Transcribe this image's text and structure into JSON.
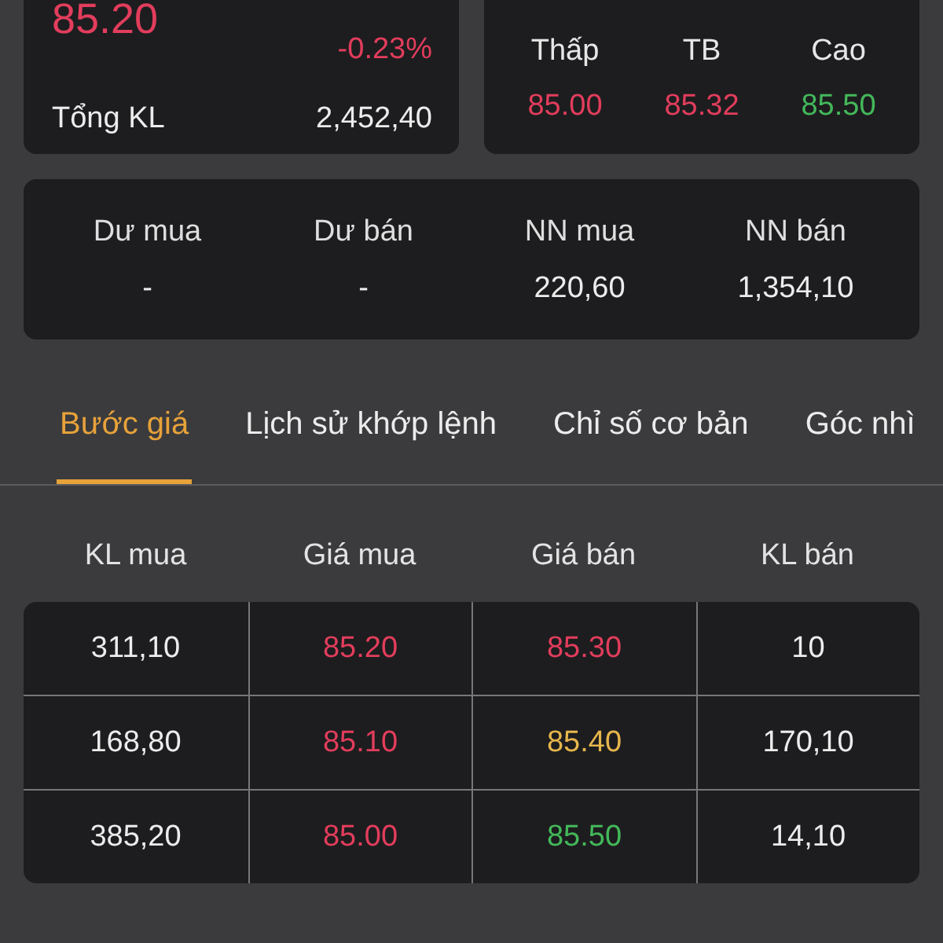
{
  "quote": {
    "price": {
      "text": "85.20",
      "color": "#e23d5c"
    },
    "change": {
      "text": "-0.23%",
      "color": "#e23d5c"
    },
    "total_volume": {
      "label": "Tổng KL",
      "value": "2,452,40"
    }
  },
  "range": [
    {
      "label": "Thấp",
      "value": "85.00",
      "color": "#e23d5c"
    },
    {
      "label": "TB",
      "value": "85.32",
      "color": "#e23d5c"
    },
    {
      "label": "Cao",
      "value": "85.50",
      "color": "#43b85a"
    }
  ],
  "summary": [
    {
      "label": "Dư mua",
      "value": "-"
    },
    {
      "label": "Dư bán",
      "value": "-"
    },
    {
      "label": "NN mua",
      "value": "220,60"
    },
    {
      "label": "NN bán",
      "value": "1,354,10"
    }
  ],
  "tabs": [
    {
      "label": "Bước giá",
      "selected": true
    },
    {
      "label": "Lịch sử khớp lệnh",
      "selected": false
    },
    {
      "label": "Chỉ số cơ bản",
      "selected": false
    },
    {
      "label": "Góc nhì",
      "selected": false
    }
  ],
  "order_book": {
    "columns": [
      "KL mua",
      "Giá mua",
      "Giá bán",
      "KL bán"
    ],
    "rows": [
      {
        "buy_volume": "311,10",
        "buy_price": {
          "text": "85.20",
          "color": "#e23d5c"
        },
        "sell_price": {
          "text": "85.30",
          "color": "#e23d5c"
        },
        "sell_volume": "10"
      },
      {
        "buy_volume": "168,80",
        "buy_price": {
          "text": "85.10",
          "color": "#e23d5c"
        },
        "sell_price": {
          "text": "85.40",
          "color": "#e6b64c"
        },
        "sell_volume": "170,10"
      },
      {
        "buy_volume": "385,20",
        "buy_price": {
          "text": "85.00",
          "color": "#e23d5c"
        },
        "sell_price": {
          "text": "85.50",
          "color": "#43b85a"
        },
        "sell_volume": "14,10"
      }
    ]
  }
}
